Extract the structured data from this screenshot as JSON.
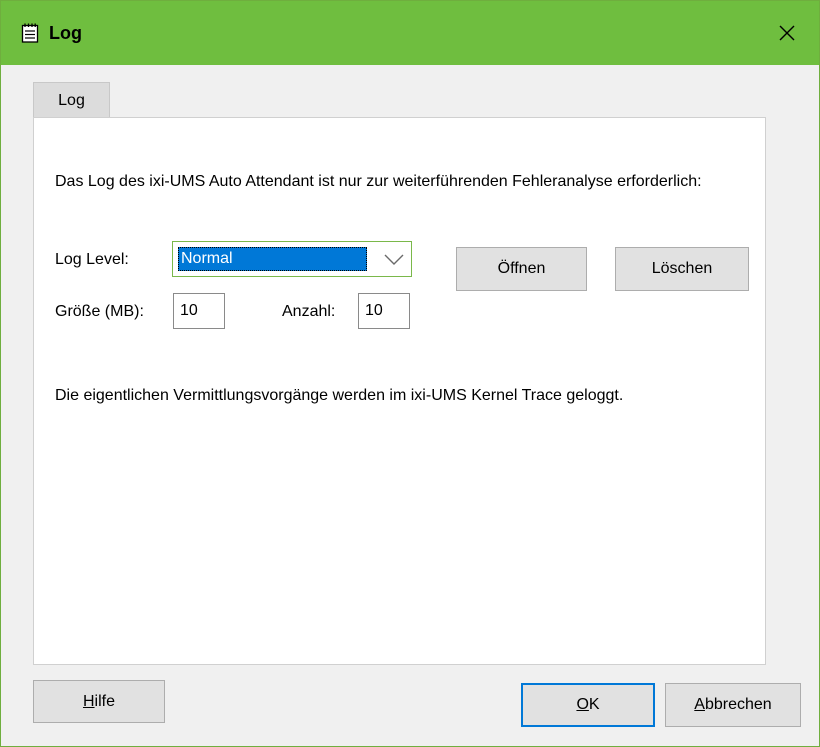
{
  "window": {
    "title": "Log"
  },
  "tabs": [
    {
      "label": "Log"
    }
  ],
  "panel": {
    "description": "Das Log des ixi-UMS Auto Attendant ist nur zur weiterführenden Fehleranalyse erforderlich:",
    "log_level": {
      "label": "Log Level:",
      "value": "Normal"
    },
    "buttons": {
      "open": "Öffnen",
      "delete": "Löschen"
    },
    "size": {
      "label": "Größe (MB):",
      "value": "10"
    },
    "count": {
      "label": "Anzahl:",
      "value": "10"
    },
    "note": "Die eigentlichen Vermittlungsvorgänge werden im ixi-UMS Kernel Trace geloggt."
  },
  "footer": {
    "help": {
      "label": "Hilfe",
      "accel": "H",
      "rest": "ilfe"
    },
    "ok": {
      "label": "OK",
      "accel": "O",
      "rest": "K"
    },
    "cancel": {
      "label": "Abbrechen",
      "accel": "A",
      "rest": "bbrechen"
    }
  },
  "colors": {
    "titlebar": "#6fbe3f",
    "selection": "#0078d7",
    "focus_border": "#7ab84a"
  },
  "icons": {
    "title": "notepad-icon",
    "close": "close-icon",
    "dropdown": "chevron-down-icon"
  }
}
